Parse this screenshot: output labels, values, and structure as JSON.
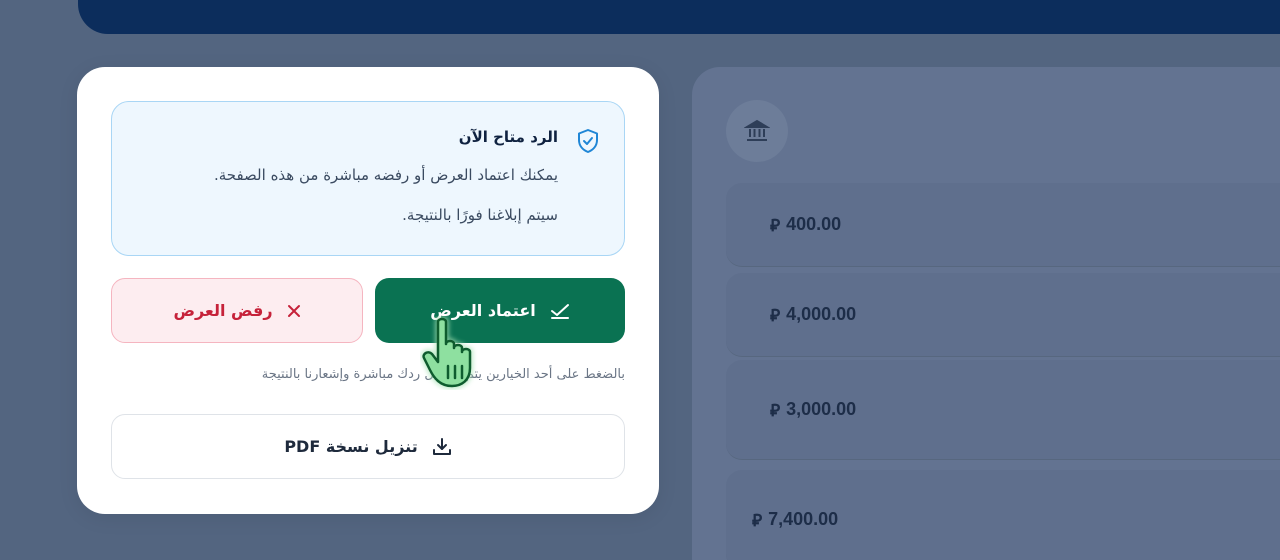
{
  "info": {
    "title": "الرد متاح الآن",
    "line1": "يمكنك اعتماد العرض أو رفضه مباشرة من هذه الصفحة.",
    "line2": "سيتم إبلاغنا فورًا بالنتيجة."
  },
  "actions": {
    "approve_label": "اعتماد العرض",
    "reject_label": "رفض العرض",
    "hint": "بالضغط على أحد الخيارين يتم تسجيل ردك مباشرة وإشعارنا بالنتيجة",
    "pdf_label": "تنزيل نسخة PDF"
  },
  "amounts": [
    "400.00",
    "4,000.00",
    "3,000.00",
    "7,400.00"
  ],
  "colors": {
    "approve": "#0a7252",
    "reject_text": "#c6223a",
    "info_border": "#a9d6f5",
    "header": "#0c2d5c"
  },
  "icons": {
    "info": "shield-check-icon",
    "approve": "check-icon",
    "reject": "close-icon",
    "pdf": "download-icon",
    "bank": "bank-icon",
    "currency": "riyal-icon"
  }
}
